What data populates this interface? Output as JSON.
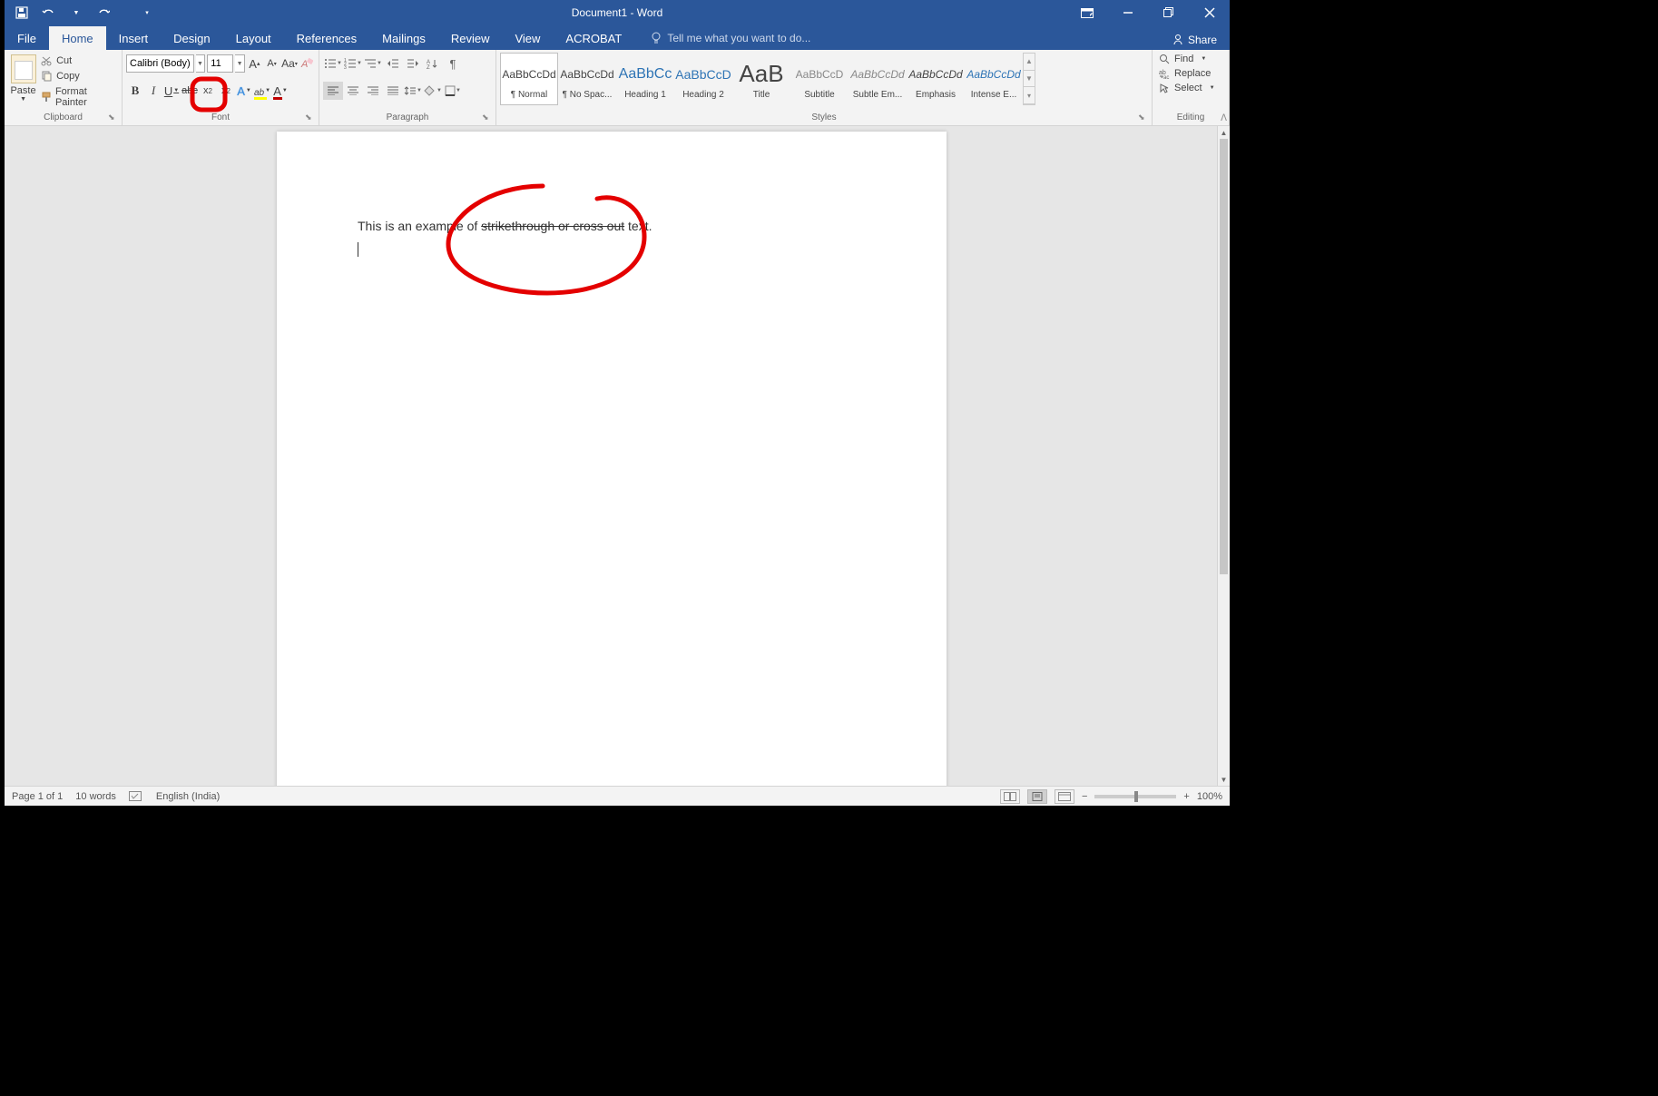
{
  "titlebar": {
    "document_title": "Document1 - Word"
  },
  "tabs": {
    "file": "File",
    "home": "Home",
    "insert": "Insert",
    "design": "Design",
    "layout": "Layout",
    "references": "References",
    "mailings": "Mailings",
    "review": "Review",
    "view": "View",
    "acrobat": "ACROBAT",
    "tell_me": "Tell me what you want to do...",
    "share": "Share"
  },
  "clipboard": {
    "paste": "Paste",
    "cut": "Cut",
    "copy": "Copy",
    "format_painter": "Format Painter",
    "group_label": "Clipboard"
  },
  "font": {
    "name": "Calibri (Body)",
    "size": "11",
    "grow": "A",
    "shrink": "A",
    "case": "Aa",
    "bold": "B",
    "italic": "I",
    "underline": "U",
    "strike": "abc",
    "sub": "x",
    "sup": "x",
    "group_label": "Font"
  },
  "paragraph": {
    "group_label": "Paragraph"
  },
  "styles": {
    "items": [
      {
        "preview": "AaBbCcDd",
        "name": "¶ Normal",
        "color": "#444",
        "size": "12px"
      },
      {
        "preview": "AaBbCcDd",
        "name": "¶ No Spac...",
        "color": "#444",
        "size": "12px"
      },
      {
        "preview": "AaBbCc",
        "name": "Heading 1",
        "color": "#2e74b5",
        "size": "16px"
      },
      {
        "preview": "AaBbCcD",
        "name": "Heading 2",
        "color": "#2e74b5",
        "size": "14px"
      },
      {
        "preview": "AaB",
        "name": "Title",
        "color": "#444",
        "size": "26px"
      },
      {
        "preview": "AaBbCcD",
        "name": "Subtitle",
        "color": "#888",
        "size": "12px"
      },
      {
        "preview": "AaBbCcDd",
        "name": "Subtle Em...",
        "color": "#888",
        "size": "12px",
        "italic": true
      },
      {
        "preview": "AaBbCcDd",
        "name": "Emphasis",
        "color": "#444",
        "size": "12px",
        "italic": true
      },
      {
        "preview": "AaBbCcDd",
        "name": "Intense E...",
        "color": "#2e74b5",
        "size": "12px",
        "italic": true
      }
    ],
    "group_label": "Styles"
  },
  "editing": {
    "find": "Find",
    "replace": "Replace",
    "select": "Select",
    "group_label": "Editing"
  },
  "document": {
    "text_before": "This is an example of ",
    "text_strike": "strikethrough or cross out",
    "text_after": " text."
  },
  "statusbar": {
    "page": "Page 1 of 1",
    "words": "10 words",
    "language": "English (India)",
    "zoom": "100%"
  }
}
